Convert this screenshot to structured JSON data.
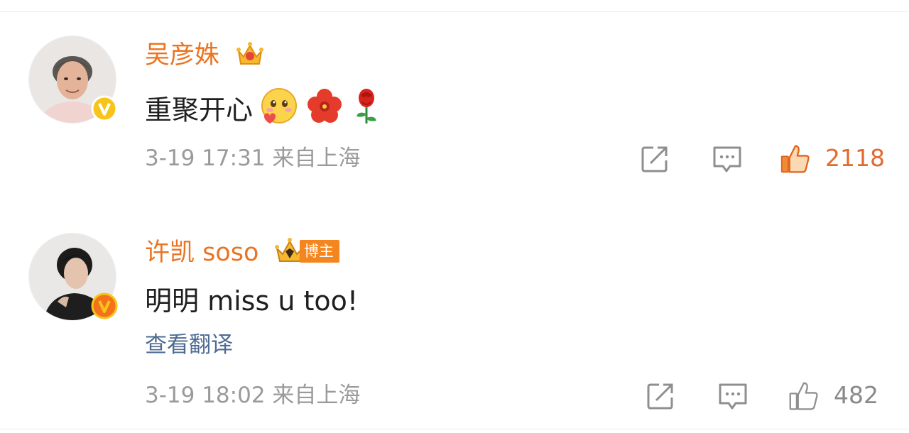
{
  "comments": [
    {
      "username": "吴彦姝",
      "content": "重聚开心",
      "emojis": [
        "blush-heart-emoji",
        "red-flower-emoji",
        "rose-emoji"
      ],
      "timestamp": "3-19 17:31",
      "location": "来自上海",
      "likes": "2118",
      "liked": true,
      "badge_icon": "crown-icon",
      "verified_icon": "gold-v-badge-icon"
    },
    {
      "username": "许凯 soso",
      "content": "明明 miss u too!",
      "translate_label": "查看翻译",
      "blogger_tag": "博主",
      "timestamp": "3-19 18:02",
      "location": "来自上海",
      "likes": "482",
      "liked": false,
      "badge_icon": "crown-icon",
      "verified_icon": "orange-v-badge-icon"
    }
  ],
  "colors": {
    "username": "#ec7320",
    "liked": "#e36a2e",
    "meta": "#9a9a9a",
    "link": "#4e6b92",
    "text": "#1f1f1f"
  }
}
